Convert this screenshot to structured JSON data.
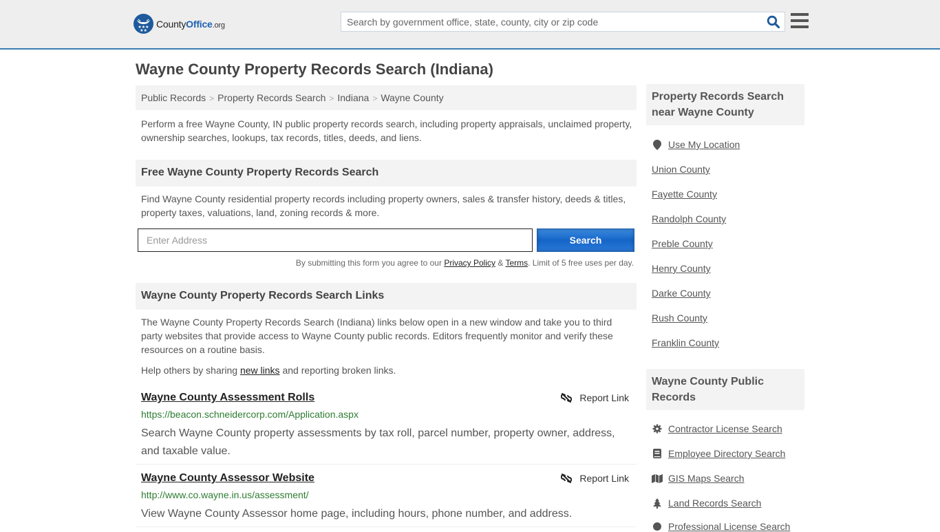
{
  "header": {
    "logo": {
      "name": "County",
      "name_bold": "Office",
      "tld": ".org"
    },
    "search": {
      "placeholder": "Search by government office, state, county, city or zip code",
      "value": ""
    },
    "colors": {
      "brand": "#1e62b0",
      "border": "#3b7db3"
    }
  },
  "page": {
    "title": "Wayne County Property Records Search (Indiana)",
    "breadcrumb": [
      {
        "label": "Public Records"
      },
      {
        "label": "Property Records Search"
      },
      {
        "label": "Indiana"
      },
      {
        "label": "Wayne County"
      }
    ],
    "intro": "Perform a free Wayne County, IN public property records search, including property appraisals, unclaimed property, ownership searches, lookups, tax records, titles, deeds, and liens."
  },
  "free_search": {
    "heading": "Free Wayne County Property Records Search",
    "description": "Find Wayne County residential property records including property owners, sales & transfer history, deeds & titles, property taxes, valuations, land, zoning records & more.",
    "input_placeholder": "Enter Address",
    "input_value": "",
    "button_label": "Search",
    "disclaimer_pre": "By submitting this form you agree to our ",
    "privacy_label": "Privacy Policy",
    "amp": " & ",
    "terms_label": "Terms",
    "disclaimer_post": ". Limit of 5 free uses per day."
  },
  "links_section": {
    "heading": "Wayne County Property Records Search Links",
    "description": "The Wayne County Property Records Search (Indiana) links below open in a new window and take you to third party websites that provide access to Wayne County public records. Editors frequently monitor and verify these resources on a routine basis.",
    "help_pre": "Help others by sharing ",
    "help_link": "new links",
    "help_post": " and reporting broken links.",
    "report_label": "Report Link",
    "items": [
      {
        "title": "Wayne County Assessment Rolls",
        "url": "https://beacon.schneidercorp.com/Application.aspx",
        "description": "Search Wayne County property assessments by tax roll, parcel number, property owner, address, and taxable value."
      },
      {
        "title": "Wayne County Assessor Website",
        "url": "http://www.co.wayne.in.us/assessment/",
        "description": "View Wayne County Assessor home page, including hours, phone number, and address."
      }
    ]
  },
  "sidebar": {
    "nearby": {
      "heading": "Property Records Search near Wayne County",
      "use_location": {
        "label": "Use My Location",
        "icon": "map-marker-icon"
      },
      "counties": [
        "Union County",
        "Fayette County",
        "Randolph County",
        "Preble County",
        "Henry County",
        "Darke County",
        "Rush County",
        "Franklin County"
      ]
    },
    "public_records": {
      "heading": "Wayne County Public Records",
      "items": [
        {
          "label": "Contractor License Search",
          "icon": "gear-icon"
        },
        {
          "label": "Employee Directory Search",
          "icon": "book-icon"
        },
        {
          "label": "GIS Maps Search",
          "icon": "map-icon"
        },
        {
          "label": "Land Records Search",
          "icon": "tree-icon"
        },
        {
          "label": "Professional License Search",
          "icon": "badge-icon"
        }
      ]
    }
  }
}
